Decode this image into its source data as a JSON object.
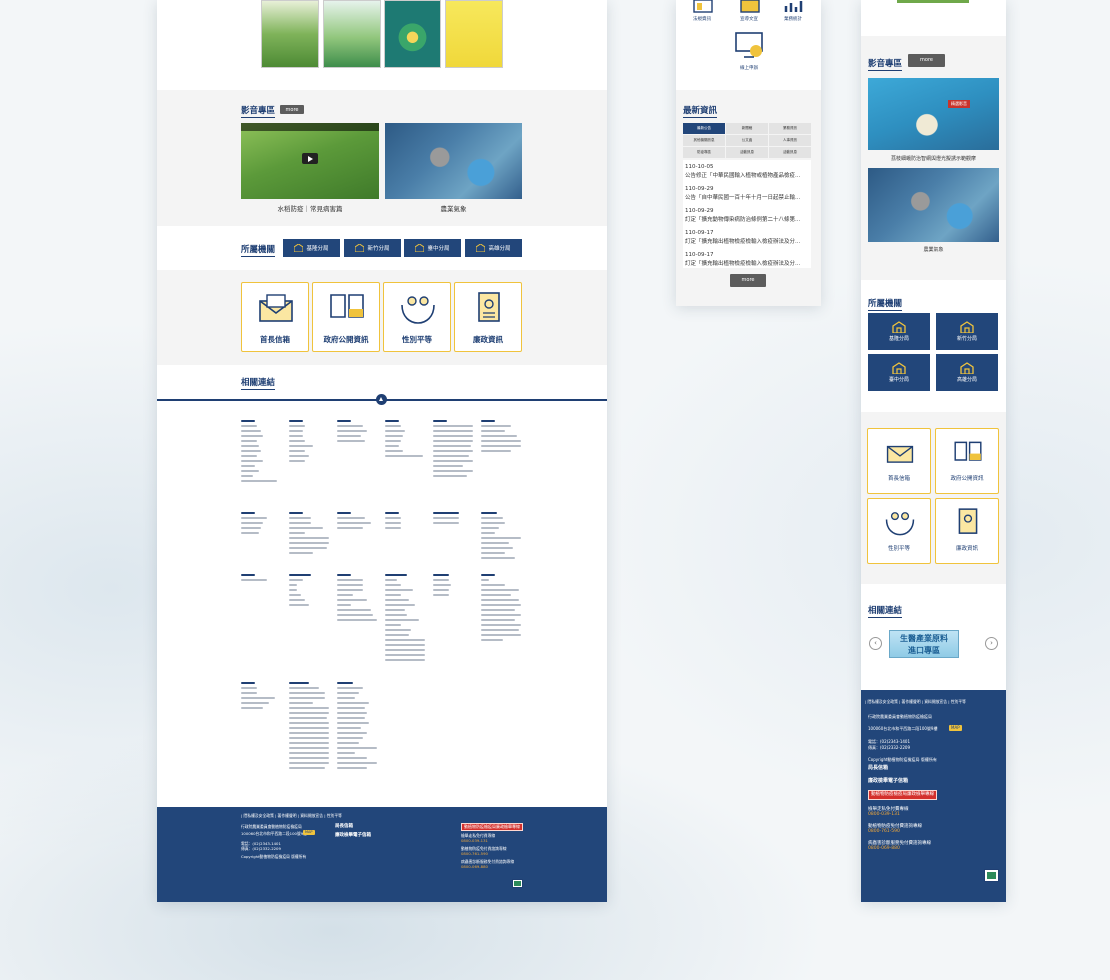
{
  "desktop": {
    "video_section": {
      "title": "影音專區",
      "more": "more",
      "videos": [
        {
          "caption": "水稻防疫｜常見病害篇"
        },
        {
          "caption": "農業氣象"
        }
      ]
    },
    "agencies": {
      "title": "所屬機關",
      "buttons": [
        "基隆分局",
        "新竹分局",
        "臺中分局",
        "高雄分局"
      ]
    },
    "services": [
      "首長信箱",
      "政府公開資訊",
      "性別平等",
      "廉政資訊"
    ],
    "related_links": {
      "title": "相關連結"
    },
    "footer": {
      "nav": "| 隱私權及安全政策 | 著作權聲明 | 資料開放宣告 | 性別平等",
      "org": "行政院農業委員會動植物防疫檢疫局",
      "address": "100060台北市和平西路二段100號9樓",
      "map": "MAP",
      "tel": "電話：(02)2343-1401",
      "fax": "傳真：(02)2332-2209",
      "copyright": "Copyright動植物防疫檢疫局 版權所有",
      "chief_mail": "局長信箱",
      "integrity_mail": "廉政檢舉電子信箱",
      "red_banner": "動植物防疫檢疫局廉政檢舉專線",
      "hotlines": [
        {
          "label": "檢舉走私免付費專線",
          "number": "0800-039-131"
        },
        {
          "label": "動植物防疫免付費諮詢專線",
          "number": "0800-761-590"
        },
        {
          "label": "病蟲害診斷服務免付費諮詢專線",
          "number": "0800-069-880"
        }
      ]
    }
  },
  "tablet": {
    "icons": [
      {
        "label": "法規資訊"
      },
      {
        "label": "宣導文宣"
      },
      {
        "label": "業務統計"
      },
      {
        "label": "線上申辦"
      }
    ],
    "news": {
      "title": "最新資訊",
      "more": "more",
      "tabs": [
        "最新公告",
        "新聞稿",
        "業務資訊",
        "其他機關訊息",
        "公文函",
        "人事資訊",
        "防疫專區",
        "活動訊息",
        "活動訊息"
      ],
      "items": [
        {
          "date": "110-10-05",
          "text": "公告修正「中華民國輸入植物或植物產品檢疫..."
        },
        {
          "date": "110-09-29",
          "text": "公告「自中華民國一百十年十月一日起禁止輸..."
        },
        {
          "date": "110-09-29",
          "text": "訂定「擴充動物傳染病防治條例第二十八條第..."
        },
        {
          "date": "110-09-17",
          "text": "訂定「擴充輸出植物檢疫檢輸入檢疫辦法及分..."
        },
        {
          "date": "110-09-17",
          "text": "訂定「擴充輸出植物檢疫檢輸入檢疫辦法及分..."
        }
      ]
    }
  },
  "mobile": {
    "video_section": {
      "title": "影音專區",
      "more": "more",
      "videos": [
        {
          "caption": "荔枝細蛾防治智網與燈光擬誘示範觀摩",
          "badge": "精選影音"
        },
        {
          "caption": "農業氣象"
        }
      ]
    },
    "agencies": {
      "title": "所屬機關",
      "buttons": [
        "基隆分局",
        "新竹分局",
        "臺中分局",
        "高雄分局"
      ]
    },
    "services": [
      "首長信箱",
      "政府公開資訊",
      "性別平等",
      "廉政資訊"
    ],
    "related_links": {
      "title": "相關連結",
      "banner_line1": "生醫產業原料",
      "banner_line2": "進口專區"
    },
    "footer": {
      "nav": "| 隱私權及安全政策 | 著作權聲明 | 資料開放宣告 | 性別平等",
      "org": "行政院農業委員會動植物防疫檢疫局",
      "address": "100060台北市和平西路二段100號9樓",
      "map": "MAP",
      "tel": "電話：(02)2343-1401",
      "fax": "傳真：(02)2332-2209",
      "copyright": "Copyright動植物防疫檢疫局 版權所有",
      "chief_mail": "局長信箱",
      "integrity_mail": "廉政檢舉電子信箱",
      "red_banner": "動植物防疫檢疫局廉政檢舉專線",
      "hotlines": [
        {
          "label": "檢舉走私免付費專線",
          "number": "0800-039-131"
        },
        {
          "label": "動植物防疫免付費諮詢專線",
          "number": "0800-761-590"
        },
        {
          "label": "病蟲害診斷服務免付費諮詢專線",
          "number": "0800-069-880"
        }
      ]
    }
  },
  "colors": {
    "navy": "#22467a",
    "gold": "#f0c33c",
    "red": "#d4302c",
    "orange_number": "#f2a93b"
  }
}
